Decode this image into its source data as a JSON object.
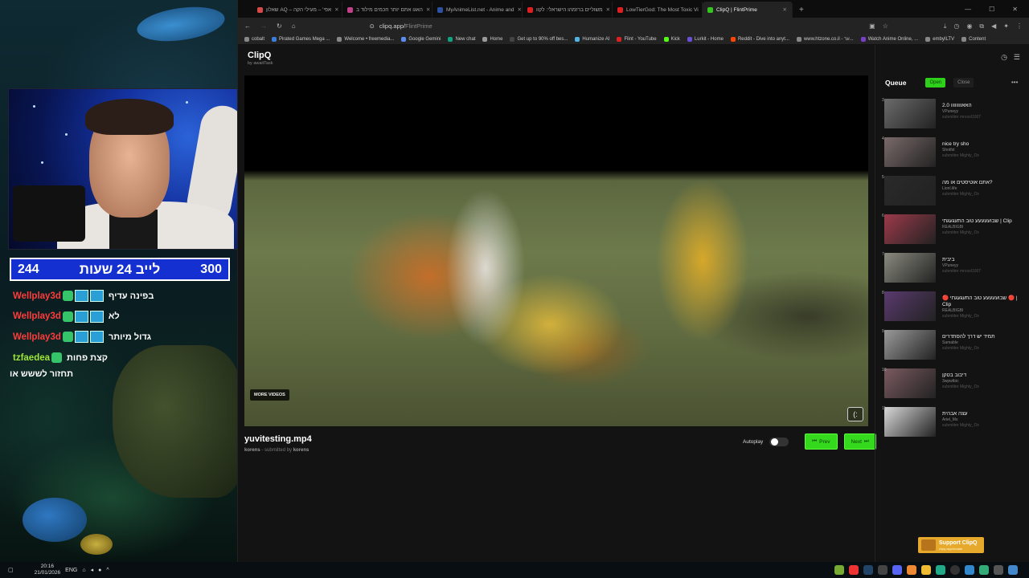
{
  "stream": {
    "counter_left": "244",
    "counter_title": "לייב 24 שעות",
    "counter_right": "300",
    "chat": [
      {
        "user": "Wellplay3d",
        "color": "red",
        "message": "בפינה עדיף"
      },
      {
        "user": "Wellplay3d",
        "color": "red",
        "message": "לא"
      },
      {
        "user": "Wellplay3d",
        "color": "red",
        "message": "גדול מיותר"
      },
      {
        "user": "tzfaedea",
        "color": "green",
        "message": "קצת פחות"
      }
    ],
    "chat_solo": "תחזור לששש או"
  },
  "taskbar": {
    "time": "20:16",
    "date": "21/01/2026",
    "lang": "ENG"
  },
  "browser": {
    "tabs": [
      {
        "label": "שאלון AQ – אפי' – מעילי הקה",
        "color": "#d64a4a",
        "active": false
      },
      {
        "label": "האגו אתם יותר חכמים מילוד ב",
        "color": "#c0408a",
        "active": false
      },
      {
        "label": "MyAnimeList.net - Anime and",
        "color": "#2e51a2",
        "active": false
      },
      {
        "label": "משוליים ברזמהו הישראלי: לקוו",
        "color": "#e02020",
        "active": false
      },
      {
        "label": "LowTierGod: The Most Toxic Vi",
        "color": "#e02020",
        "active": false
      },
      {
        "label": "ClipQ | FlintPrime",
        "color": "#36c41f",
        "active": true
      }
    ],
    "url_host": "clipq.app/",
    "url_path": "FlintPrime",
    "bookmarks": [
      {
        "label": "cobalt",
        "color": "#888"
      },
      {
        "label": "Pirated Games Mega ...",
        "color": "#3b7dd8"
      },
      {
        "label": "Welcome • freemedia...",
        "color": "#888"
      },
      {
        "label": "Google Gemini",
        "color": "#5b8cf0"
      },
      {
        "label": "New chat",
        "color": "#10a37f"
      },
      {
        "label": "Home",
        "color": "#999"
      },
      {
        "label": "Get up to 90% off bes...",
        "color": "#444"
      },
      {
        "label": "Humanize AI",
        "color": "#4fb3e6"
      },
      {
        "label": "Flint - YouTube",
        "color": "#e02020"
      },
      {
        "label": "Kick",
        "color": "#53fc18"
      },
      {
        "label": "Lurkit - Home",
        "color": "#6b4fd8"
      },
      {
        "label": "Reddit - Dive into anyt...",
        "color": "#ff4500"
      },
      {
        "label": "www.htzone.co.il - ער...",
        "color": "#888"
      },
      {
        "label": "Watch Anime Online, ...",
        "color": "#7a3fc8"
      },
      {
        "label": "embyILTV",
        "color": "#888"
      },
      {
        "label": "Content",
        "color": "#888"
      }
    ]
  },
  "app": {
    "title": "ClipQ",
    "subtitle": "by awaitTask",
    "player": {
      "more_videos": "MORE VIDEOS",
      "fullscreen_icon": "(:"
    },
    "video": {
      "title": "yuvitesting.mp4",
      "channel": "korens",
      "submitted_prefix": " - submitted by ",
      "submitter": "korens"
    },
    "controls": {
      "autoplay_label": "Autoplay",
      "prev_label": "Prev",
      "next_label": "Next"
    },
    "queue": {
      "title": "Queue",
      "open_label": "Open",
      "close_label": "Close",
      "items": [
        {
          "num": "3",
          "title": "2.0 האאוווווווו",
          "channel": "VPuneyy",
          "submitter": "submitter mrcool1007",
          "thumb": "#6b6b6b"
        },
        {
          "num": "4",
          "title": "nice try sho",
          "channel": "Shotfst",
          "submitter": "submitter Mighty_Oz",
          "thumb": "#7a6a6a"
        },
        {
          "num": "5",
          "title": "אתם אוטיסטים או מה?",
          "channel": "Lionl.life",
          "submitter": "submitter Mighty_Oz",
          "thumb": "#2a2a2a"
        },
        {
          "num": "6",
          "title": "שבועעעעע טוב התעגעגתי | Clip",
          "channel": "REALBIGBI",
          "submitter": "submitter Mighty_Oz",
          "thumb": "#9c3a4a"
        },
        {
          "num": "7",
          "title": "ביבית",
          "channel": "VPuneyy",
          "submitter": "submitter mrcool1007",
          "thumb": "#8a8a80"
        },
        {
          "num": "8",
          "title": "🔴 שבועעעעע טוב התעגעגתי 🔴 | Clip",
          "channel": "REALBIGBI",
          "submitter": "submitter Mighty_Oz",
          "thumb": "#5a3a6e"
        },
        {
          "num": "9",
          "title": "תמיד יש דרך להסתדרים",
          "channel": "Samable",
          "submitter": "submitter Mighty_Oz",
          "thumb": "#9a9a9a"
        },
        {
          "num": "10",
          "title": "דיבוב בטקן",
          "channel": "3wpwtbic",
          "submitter": "submitter Mighty_Oz",
          "thumb": "#7a5a60"
        },
        {
          "num": "11",
          "title": "עצה אבהית",
          "channel": "Ariel_Ms",
          "submitter": "submitter Mighty_Oz",
          "thumb": "#d8d8d8"
        }
      ]
    },
    "support": {
      "label": "Support ClipQ",
      "sub": "clipq.app/donate"
    }
  }
}
